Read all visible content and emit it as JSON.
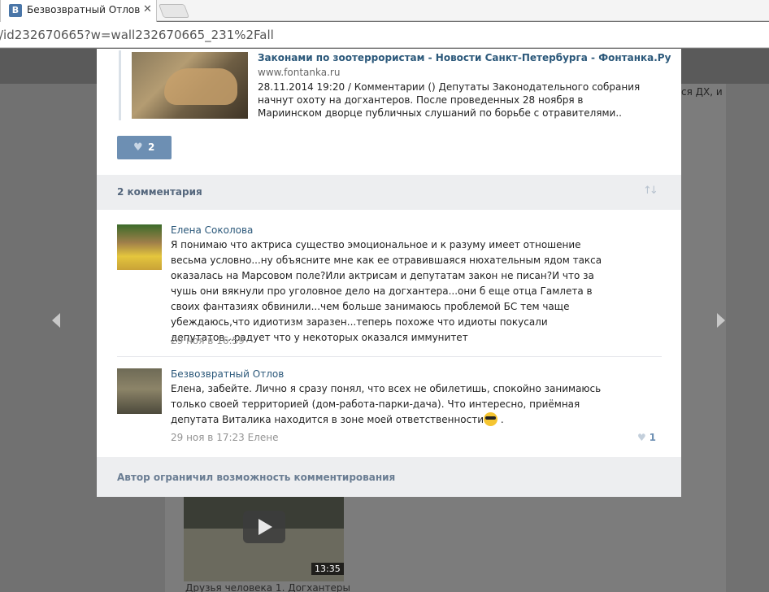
{
  "browser": {
    "tab_title": "Безвозвратный Отлов | В",
    "favicon": "В",
    "close": "✕",
    "url": "/id232670665?w=wall232670665_231%2Fall"
  },
  "background": {
    "right_text": "ся ДХ, и",
    "video_duration": "13:35",
    "video_caption": "Друзья человека 1. Догхантеры"
  },
  "post": {
    "share": {
      "title": "Законами по зоотеррористам - Новости Санкт-Петербурга - Фонтанка.Ру",
      "domain": "www.fontanka.ru",
      "description": "28.11.2014 19:20 / Комментарии () Депутаты Законодательного собрания начнут охоту на догхантеров. После проведенных 28 ноября в Мариинском дворце публичных слушаний по борьбе с отравителями.."
    },
    "likes": "2",
    "comments_header": "2 комментария"
  },
  "comments": [
    {
      "author": "Елена Соколова",
      "text": "Я понимаю что актриса существо эмоциональное и к разуму имеет отношение весьма условно...ну объясните мне как ее отравившаяся нюхательным ядом такса оказалась на Марсовом поле?Или актрисам и депутатам закон не писан?И что за чушь они вякнули про уголовное дело на догхантера...они б еще отца Гамлета в своих фантазиях обвинили...чем больше занимаюсь проблемой БС тем чаще убеждаюсь,что идиотизм заразен...теперь похоже что идиоты покусали депутатов...радует что у некоторых оказался иммунитет",
      "date": "29 ноя в 16:59"
    },
    {
      "author": "Безвозвратный Отлов",
      "text": "Елена, забейте. Лично я сразу понял, что всех не обилетишь, спокойно занимаюсь только своей территорией (дом-работа-парки-дача). Что интересно, приёмная депутата Виталика находится в зоне моей ответственности",
      "text_suffix": " .",
      "date": "29 ноя в 17:23 Елене",
      "likes": "1"
    }
  ],
  "footer": {
    "text": "Автор ограничил возможность комментирования"
  },
  "icons": {
    "heart": "♥",
    "sort": "↑↓"
  }
}
